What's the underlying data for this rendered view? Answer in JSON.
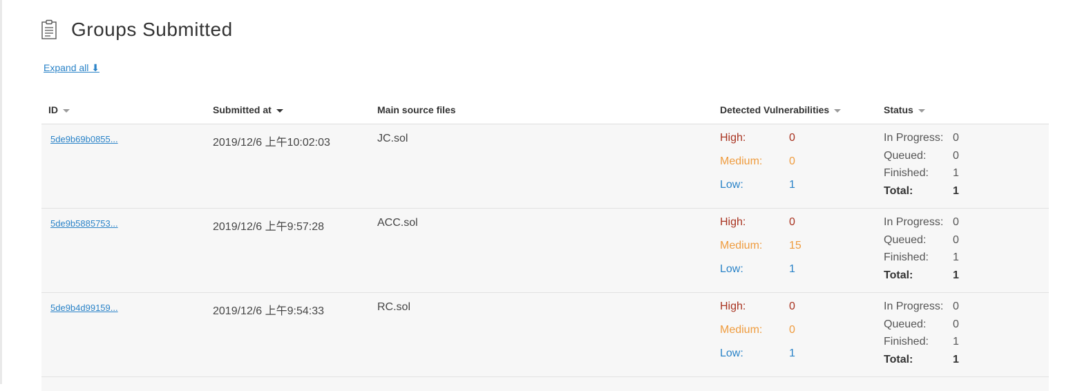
{
  "header": {
    "icon": "clipboard-icon",
    "title": "Groups Submitted"
  },
  "expand_all": "Expand all ⬇",
  "table": {
    "columns": {
      "id": "ID",
      "submitted_at": "Submitted at",
      "main_source_files": "Main source files",
      "detected_vulnerabilities": "Detected Vulnerabilities",
      "status": "Status"
    },
    "labels": {
      "high": "High:",
      "medium": "Medium:",
      "low": "Low:",
      "in_progress": "In Progress:",
      "queued": "Queued:",
      "finished": "Finished:",
      "total": "Total:"
    },
    "rows": [
      {
        "id": "5de9b69b0855...",
        "submitted_at": "2019/12/6 上午10:02:03",
        "file": "JC.sol",
        "high": "0",
        "medium": "0",
        "low": "1",
        "in_progress": "0",
        "queued": "0",
        "finished": "1",
        "total": "1"
      },
      {
        "id": "5de9b5885753...",
        "submitted_at": "2019/12/6 上午9:57:28",
        "file": "ACC.sol",
        "high": "0",
        "medium": "15",
        "low": "1",
        "in_progress": "0",
        "queued": "0",
        "finished": "1",
        "total": "1"
      },
      {
        "id": "5de9b4d99159...",
        "submitted_at": "2019/12/6 上午9:54:33",
        "file": "RC.sol",
        "high": "0",
        "medium": "0",
        "low": "1",
        "in_progress": "0",
        "queued": "0",
        "finished": "1",
        "total": "1"
      }
    ]
  },
  "colors": {
    "link": "#2a83c8",
    "high": "#a8321f",
    "medium": "#ef9c3f",
    "low": "#2a83c8",
    "row_bg": "#f7f7f7"
  }
}
